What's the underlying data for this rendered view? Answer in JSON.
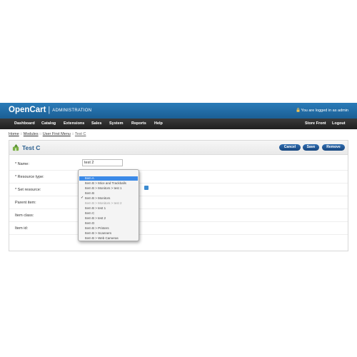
{
  "header": {
    "brand": "OpenCart",
    "separator": "|",
    "subtitle": "ADMINISTRATION",
    "login_text": "You are logged in as admin"
  },
  "menu": {
    "dashboard": "Dashboard",
    "catalog": "Catalog",
    "extensions": "Extensions",
    "sales": "Sales",
    "system": "System",
    "reports": "Reports",
    "help": "Help",
    "store_front": "Store Front",
    "logout": "Logout"
  },
  "breadcrumb": {
    "home": "Home",
    "modules": "Modules",
    "user_first_menu": "User First Menu",
    "current": "Test C",
    "sep": "::"
  },
  "page": {
    "title": "Test C",
    "cancel": "Cancel",
    "save": "Save",
    "remove": "Remove"
  },
  "form": {
    "name_label": "* Name:",
    "name_value": "test 2",
    "resource_type_label": "* Resource type:",
    "set_resource_label": "* Set resource:",
    "parent_item_label": "Parent item:",
    "item_class_label": "Item class:",
    "item_id_label": "Item id:"
  },
  "dropdown": {
    "items": [
      "Item A",
      "Item B > Mice and Trackballs",
      "Item B > Monitors > test 1",
      "Item B",
      "Item B > Monitors",
      "Item B > Monitors > test 2",
      "Item B > test 1",
      "Item C",
      "Item B > test 2",
      "Item D",
      "Item B > Printers",
      "Item B > Scanners",
      "Item B > Web Cameras"
    ],
    "highlighted_index": 0,
    "checked_index": 4,
    "disabled_index": 5,
    "check_mark": "✓"
  },
  "colors": {
    "header_blue": "#1b5f95",
    "menubar_dark": "#1f1f1f",
    "button_blue": "#17467e",
    "highlight_blue": "#3b8ae8"
  }
}
